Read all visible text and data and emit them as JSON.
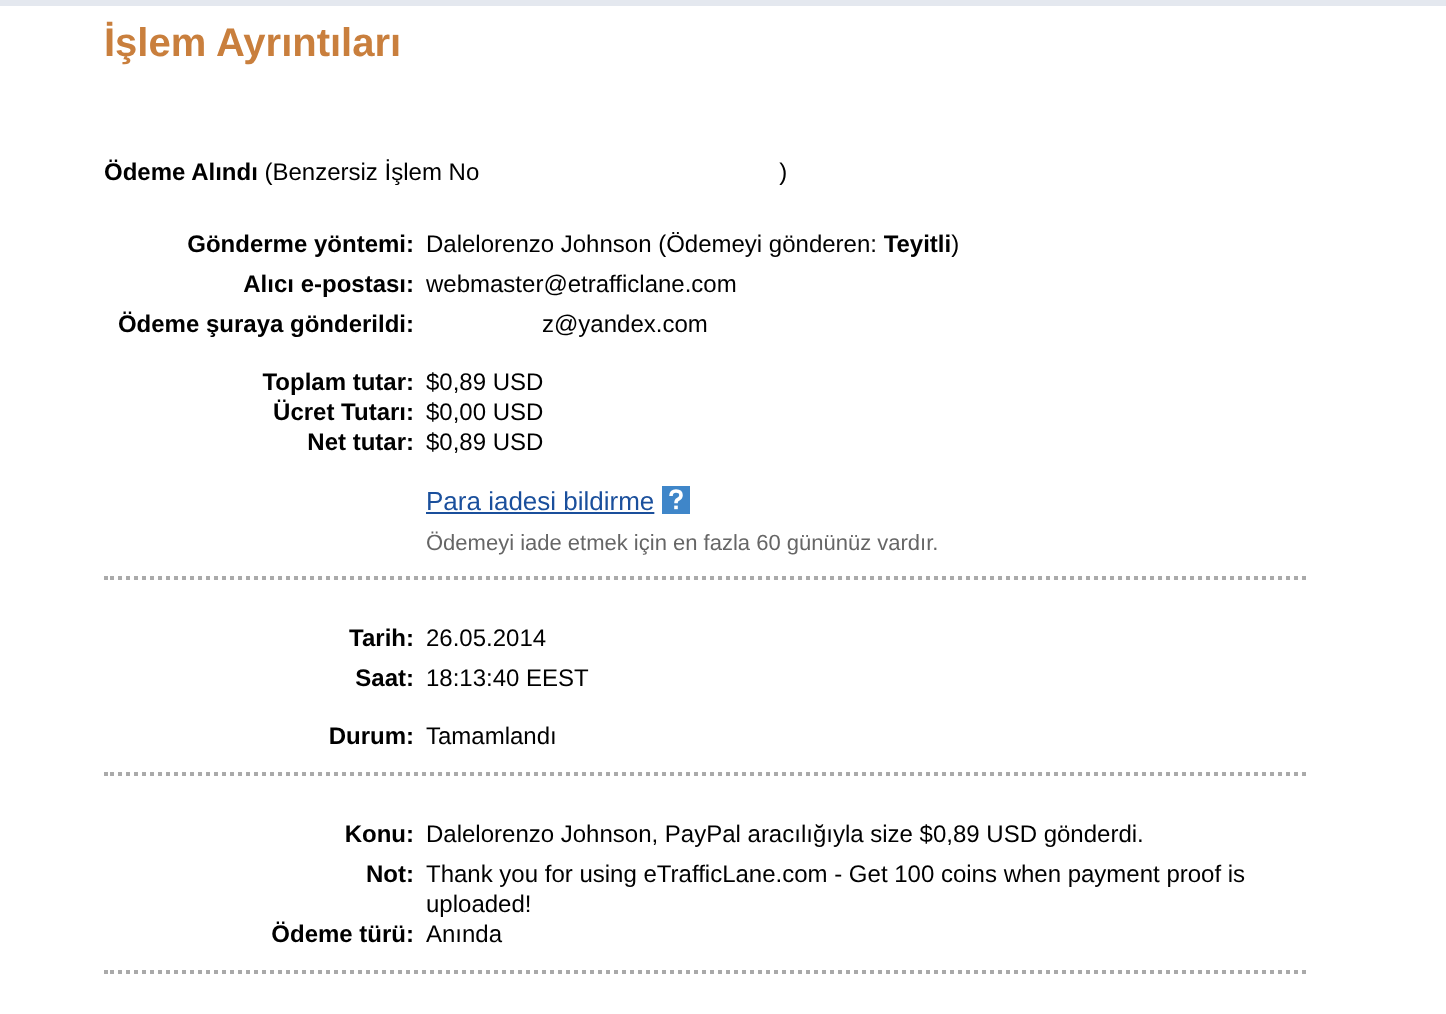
{
  "title": "İşlem Ayrıntıları",
  "receipt": {
    "label": "Ödeme Alındı",
    "note": "(Benzersiz İşlem No",
    "note_end": ")"
  },
  "sections": [
    {
      "groups": [
        [
          {
            "label": "Gönderme yöntemi:",
            "value": "Dalelorenzo Johnson (Ödemeyi gönderen: **Teyitli**)"
          },
          {
            "label": "Alıcı e-postası:",
            "value": "webmaster@etrafficlane.com"
          },
          {
            "label": "Ödeme şuraya gönderildi:",
            "value": "z@yandex.com",
            "kind": "masked"
          }
        ],
        [
          {
            "label": "Toplam tutar:",
            "value": "$0,89 USD"
          },
          {
            "label": "Ücret Tutarı:",
            "value": "$0,00 USD",
            "kind": "tight"
          },
          {
            "label": "Net tutar:",
            "value": "$0,89 USD",
            "kind": "tight"
          }
        ]
      ],
      "refund": {
        "link": "Para iadesi bildirme",
        "note": "Ödemeyi iade etmek için en fazla 60 gününüz vardır."
      }
    },
    {
      "groups": [
        [
          {
            "label": "Tarih:",
            "value": "26.05.2014"
          },
          {
            "label": "Saat:",
            "value": "18:13:40 EEST"
          }
        ],
        [
          {
            "label": "Durum:",
            "value": "Tamamlandı"
          }
        ]
      ]
    },
    {
      "groups": [
        [
          {
            "label": "Konu:",
            "value": "Dalelorenzo Johnson, PayPal aracılığıyla size $0,89 USD gönderdi."
          },
          {
            "label": "Not:",
            "value": "Thank you for using eTrafficLane.com - Get 100 coins when payment proof is uploaded!"
          },
          {
            "label": "Ödeme türü:",
            "value": "Anında",
            "kind": "tight"
          }
        ]
      ]
    }
  ]
}
